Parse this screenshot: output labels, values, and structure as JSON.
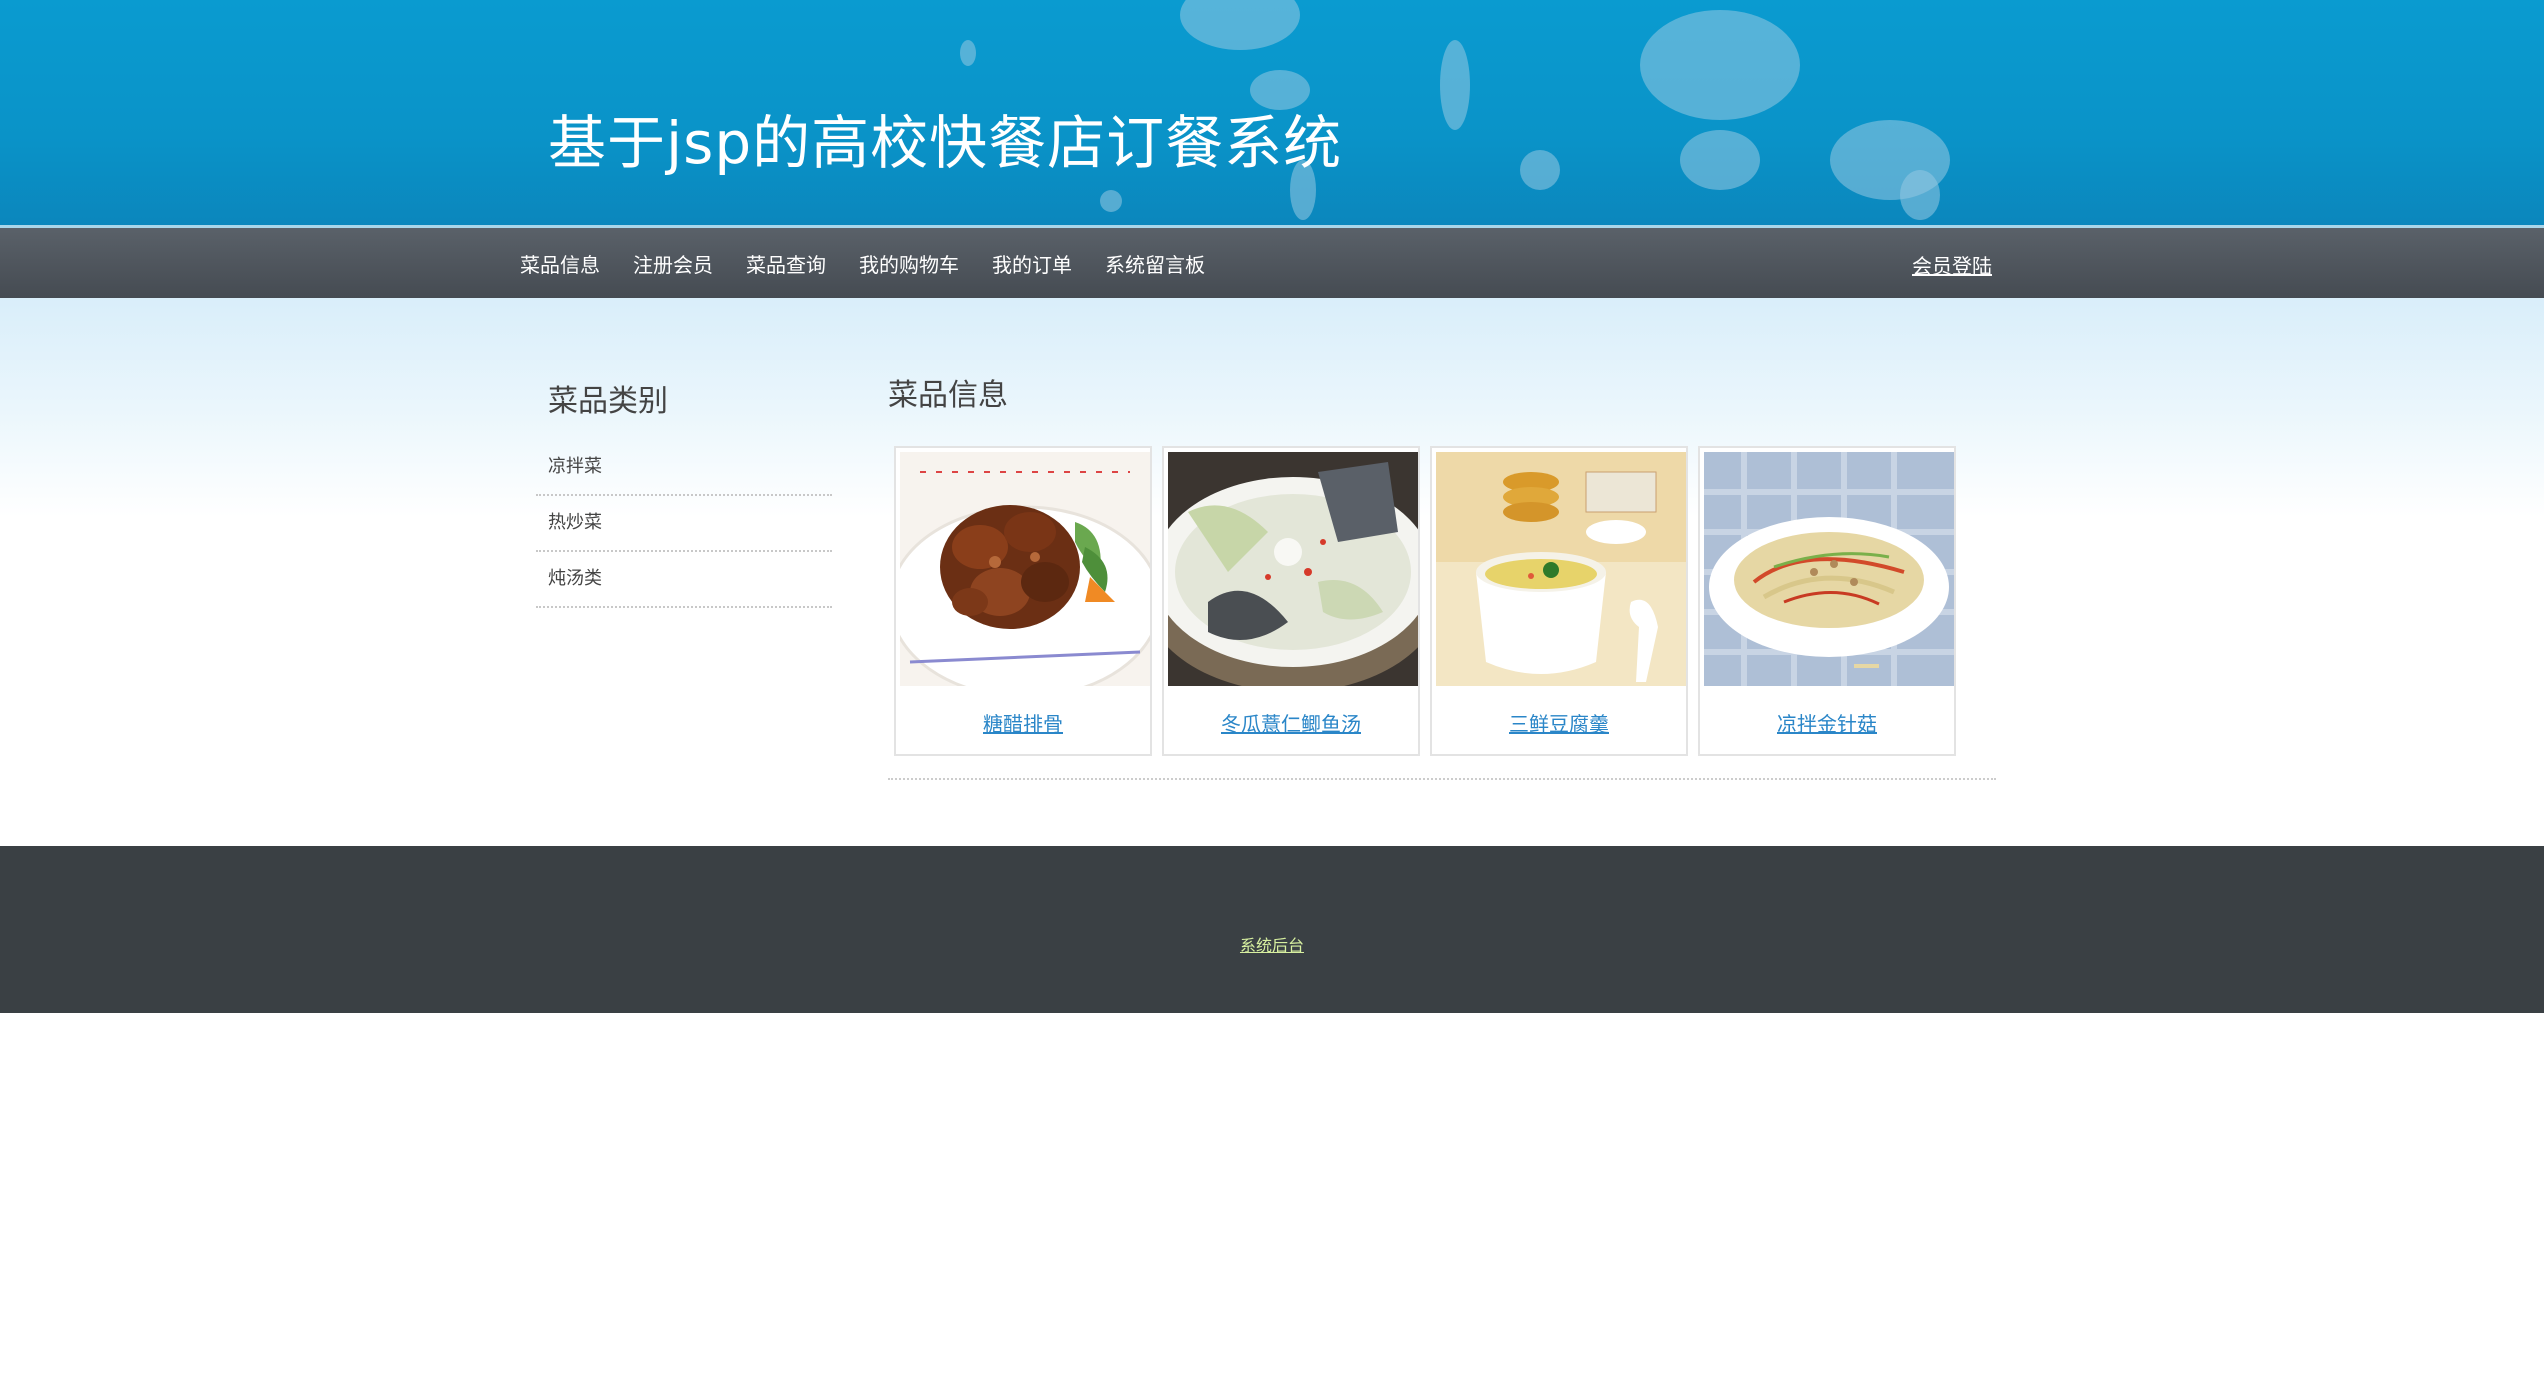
{
  "header": {
    "site_title": "基于jsp的高校快餐店订餐系统"
  },
  "nav": {
    "items": [
      {
        "label": "菜品信息"
      },
      {
        "label": "注册会员"
      },
      {
        "label": "菜品查询"
      },
      {
        "label": "我的购物车"
      },
      {
        "label": "我的订单"
      },
      {
        "label": "系统留言板"
      }
    ],
    "login_label": "会员登陆"
  },
  "sidebar": {
    "title": "菜品类别",
    "categories": [
      {
        "label": "凉拌菜"
      },
      {
        "label": "热炒菜"
      },
      {
        "label": "炖汤类"
      }
    ]
  },
  "main": {
    "title": "菜品信息",
    "dishes": [
      {
        "name": "糖醋排骨",
        "image": "sweet-sour-ribs"
      },
      {
        "name": "冬瓜薏仁鲫鱼汤",
        "image": "winter-melon-fish-soup"
      },
      {
        "name": "三鲜豆腐羹",
        "image": "tofu-soup"
      },
      {
        "name": "凉拌金针菇",
        "image": "enoki-salad"
      }
    ]
  },
  "footer": {
    "admin_link": "系统后台"
  },
  "colors": {
    "header_blue": "#0a97cc",
    "nav_gray": "#4e545b",
    "link_blue": "#2a86c8",
    "footer_dark": "#3a4044",
    "footer_link": "#d7f0a0"
  }
}
